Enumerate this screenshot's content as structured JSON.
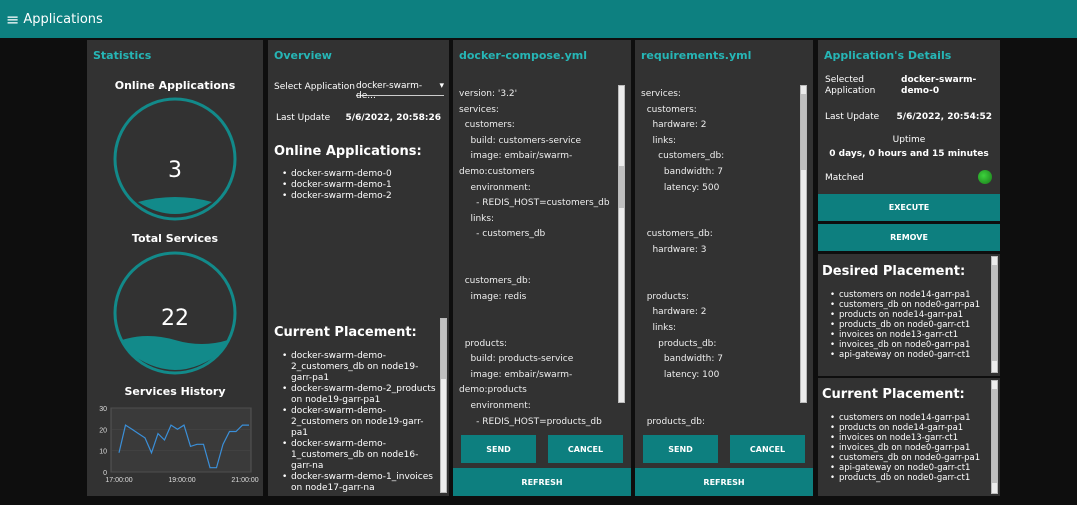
{
  "header": {
    "menu_icon": "hamburger-icon",
    "title": "Applications"
  },
  "statistics": {
    "title": "Statistics",
    "online_apps": {
      "label": "Online Applications",
      "value": "3"
    },
    "total_services": {
      "label": "Total Services",
      "value": "22"
    },
    "history": {
      "label": "Services History",
      "chart_data": {
        "type": "line",
        "title": "Services History",
        "xlabel": "",
        "ylabel": "",
        "ylim": [
          0,
          30
        ],
        "yticks": [
          "30",
          "20",
          "10",
          "0"
        ],
        "xticks": [
          "17:00:00",
          "19:00:00",
          "21:00:00"
        ],
        "x": [
          "17:00",
          "17:15",
          "17:30",
          "17:45",
          "18:00",
          "18:15",
          "18:30",
          "18:45",
          "19:00",
          "19:15",
          "19:30",
          "19:45",
          "20:00",
          "20:15",
          "20:30",
          "20:45",
          "21:00",
          "21:10",
          "21:20",
          "21:30",
          "21:45"
        ],
        "values": [
          9,
          22,
          20,
          18,
          16,
          9,
          18,
          15,
          22,
          20,
          22,
          12,
          13,
          13,
          2,
          2,
          13,
          19,
          19,
          22,
          22
        ]
      }
    }
  },
  "overview": {
    "title": "Overview",
    "select_label": "Select Application",
    "select_value": "docker-swarm-de...",
    "update_label": "Last Update",
    "update_value": "5/6/2022, 20:58:26",
    "online_heading": "Online Applications:",
    "online_list": [
      "docker-swarm-demo-0",
      "docker-swarm-demo-1",
      "docker-swarm-demo-2"
    ],
    "placement_heading": "Current Placement:",
    "placement_list": [
      "docker-swarm-demo-2_customers_db on node19-garr-pa1",
      "docker-swarm-demo-2_products on node19-garr-pa1",
      "docker-swarm-demo-2_customers on node19-garr-pa1",
      "docker-swarm-demo-1_customers_db on node16-garr-na",
      "docker-swarm-demo-1_invoices on node17-garr-na"
    ]
  },
  "compose": {
    "title": "docker-compose.yml",
    "lines": [
      "version: '3.2'",
      "services:",
      "  customers:",
      "    build: customers-service",
      "    image: embair/swarm-",
      "demo:customers",
      "    environment:",
      "      - REDIS_HOST=customers_db",
      "    links:",
      "      - customers_db",
      "",
      "",
      "  customers_db:",
      "    image: redis",
      "",
      "",
      "  products:",
      "    build: products-service",
      "    image: embair/swarm-",
      "demo:products",
      "    environment:",
      "      - REDIS_HOST=products_db"
    ],
    "send": "SEND",
    "cancel": "CANCEL",
    "refresh": "REFRESH"
  },
  "requirements": {
    "title": "requirements.yml",
    "lines": [
      "services:",
      "  customers:",
      "    hardware: 2",
      "    links:",
      "      customers_db:",
      "        bandwidth: 7",
      "        latency: 500",
      "",
      "",
      "  customers_db:",
      "    hardware: 3",
      "",
      "",
      "  products:",
      "    hardware: 2",
      "    links:",
      "      products_db:",
      "        bandwidth: 7",
      "        latency: 100",
      "",
      "",
      "  products_db:"
    ],
    "send": "SEND",
    "cancel": "CANCEL",
    "refresh": "REFRESH"
  },
  "details": {
    "title": "Application's Details",
    "selected_label": "Selected Application",
    "selected_value": "docker-swarm-demo-0",
    "update_label": "Last Update",
    "update_value": "5/6/2022, 20:54:52",
    "uptime_label": "Uptime",
    "uptime_value": "0 days, 0 hours and 15 minutes",
    "matched_label": "Matched",
    "matched_color": "#22aa22",
    "execute": "EXECUTE",
    "remove": "REMOVE",
    "desired_heading": "Desired Placement:",
    "desired_list": [
      "customers on node14-garr-pa1",
      "customers_db on node0-garr-pa1",
      "products on node14-garr-pa1",
      "products_db on node0-garr-ct1",
      "invoices on node13-garr-ct1",
      "invoices_db on node0-garr-pa1",
      "api-gateway on node0-garr-ct1"
    ],
    "current_heading": "Current Placement:",
    "current_list": [
      "customers on node14-garr-pa1",
      "products on node14-garr-pa1",
      "invoices on node13-garr-ct1",
      "invoices_db on node0-garr-pa1",
      "customers_db on node0-garr-pa1",
      "api-gateway on node0-garr-ct1",
      "products_db on node0-garr-ct1"
    ]
  },
  "colors": {
    "accent": "#0d8080",
    "title": "#26b6b6",
    "panel": "#323232",
    "background": "#0e0e0e"
  }
}
